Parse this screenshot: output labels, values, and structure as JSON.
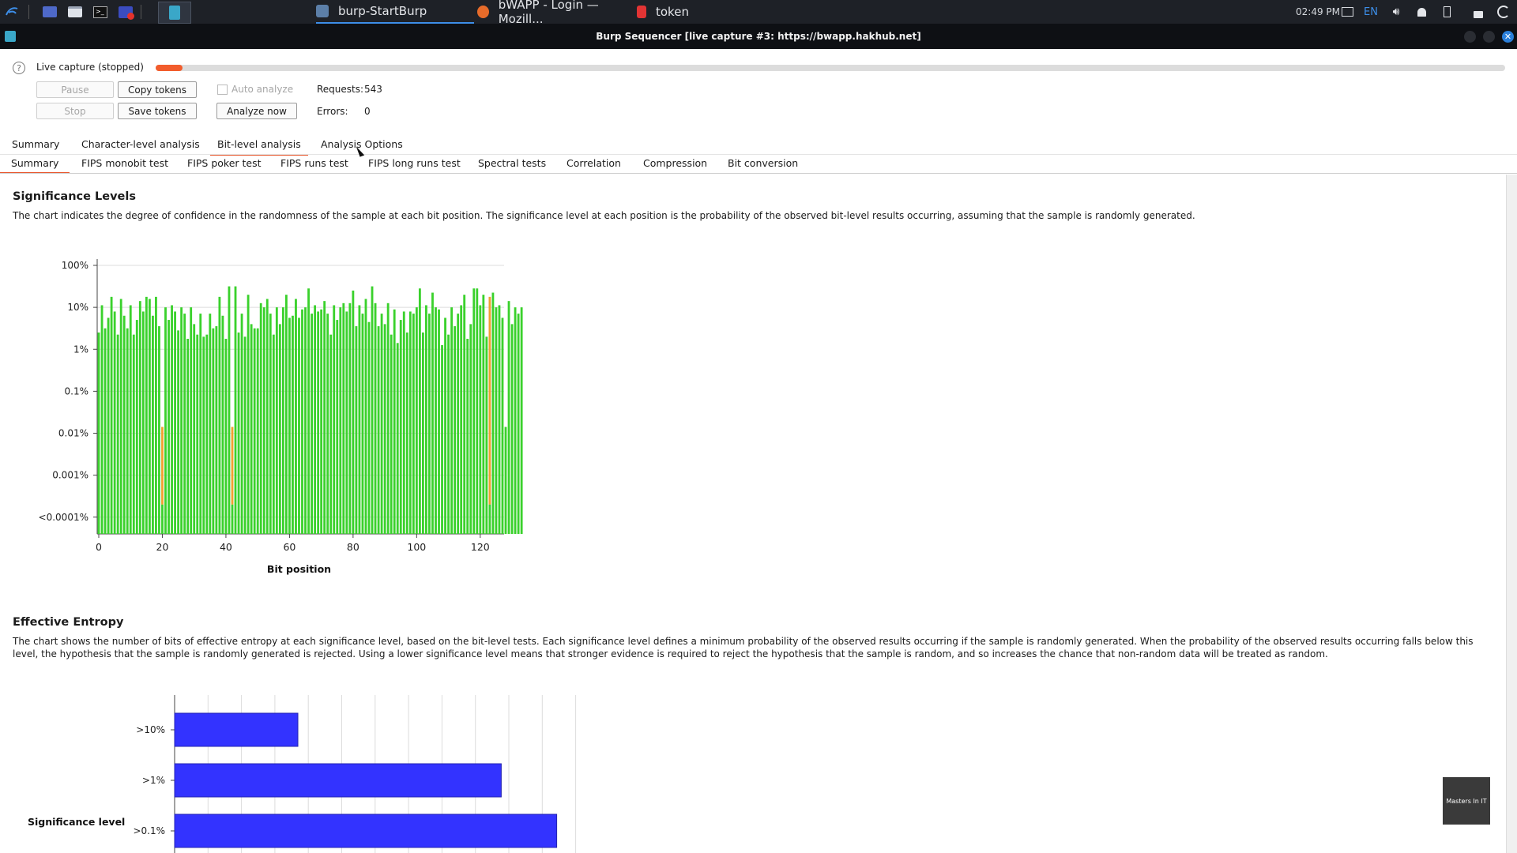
{
  "taskbar": {
    "windows": [
      {
        "label": "burp-StartBurp",
        "icon": "burp-icon",
        "active": true
      },
      {
        "label": "bWAPP - Login — Mozill...",
        "icon": "firefox-icon",
        "active": false
      },
      {
        "label": "token",
        "icon": "document-icon",
        "active": false
      }
    ],
    "time": "02:49 PM",
    "language": "EN"
  },
  "window": {
    "title": "Burp Sequencer [live capture #3: https://bwapp.hakhub.net]"
  },
  "capture": {
    "status_label": "Live capture (stopped)",
    "progress_fraction": 0.02,
    "pause_label": "Pause",
    "stop_label": "Stop",
    "copy_tokens_label": "Copy tokens",
    "save_tokens_label": "Save tokens",
    "auto_analyze_label": "Auto analyze",
    "analyze_now_label": "Analyze now",
    "requests_label": "Requests:",
    "requests_value": "543",
    "errors_label": "Errors:",
    "errors_value": "0"
  },
  "tabs_main": [
    "Summary",
    "Character-level analysis",
    "Bit-level analysis",
    "Analysis Options"
  ],
  "tabs_main_active": 2,
  "tabs_sub": [
    "Summary",
    "FIPS monobit test",
    "FIPS poker test",
    "FIPS runs test",
    "FIPS long runs test",
    "Spectral tests",
    "Correlation",
    "Compression",
    "Bit conversion"
  ],
  "tabs_sub_active": 0,
  "significance": {
    "title": "Significance Levels",
    "description": "The chart indicates the degree of confidence in the randomness of the sample at each bit position. The significance level at each position is the probability of the observed bit-level results occurring, assuming that the sample is randomly generated."
  },
  "entropy": {
    "title": "Effective Entropy",
    "description": "The chart shows the number of bits of effective entropy at each significance level, based on the bit-level tests. Each significance level defines a minimum probability of the observed results occurring if the sample is randomly generated. When the probability of the observed results occurring falls below this level, the hypothesis that the sample is randomly generated is rejected. Using a lower significance level means that stronger evidence is required to reject the hypothesis that the sample is random, and so increases the chance that non-random data will be treated as random."
  },
  "watermark_text": "Masters In IT",
  "colors": {
    "accent": "#e8552b",
    "progress": "#f25c2c",
    "bar_green": "#3ad12c",
    "bar_orange": "#f0a030",
    "bar_blue": "#3333ff"
  },
  "chart_data": [
    {
      "type": "bar",
      "title": "Significance Levels",
      "xlabel": "Bit position",
      "ylabel": "",
      "y_scale": "log",
      "y_tick_labels": [
        "100%",
        "10%",
        "1%",
        "0.1%",
        "0.01%",
        "0.001%",
        "<0.0001%"
      ],
      "x_tick_labels": [
        "0",
        "20",
        "40",
        "60",
        "80",
        "100",
        "120"
      ],
      "xlim": [
        0,
        128
      ],
      "categories": [
        0,
        1,
        2,
        3,
        4,
        5,
        6,
        7,
        8,
        9,
        10,
        11,
        12,
        13,
        14,
        15,
        16,
        17,
        18,
        19,
        20,
        21,
        22,
        23,
        24,
        25,
        26,
        27,
        28,
        29,
        30,
        31,
        32,
        33,
        34,
        35,
        36,
        37,
        38,
        39,
        40,
        41,
        42,
        43,
        44,
        45,
        46,
        47,
        48,
        49,
        50,
        51,
        52,
        53,
        54,
        55,
        56,
        57,
        58,
        59,
        60,
        61,
        62,
        63,
        64,
        65,
        66,
        67,
        68,
        69,
        70,
        71,
        72,
        73,
        74,
        75,
        76,
        77,
        78,
        79,
        80,
        81,
        82,
        83,
        84,
        85,
        86,
        87,
        88,
        89,
        90,
        91,
        92,
        93,
        94,
        95,
        96,
        97,
        98,
        99,
        100,
        101,
        102,
        103,
        104,
        105,
        106,
        107,
        108,
        109,
        110,
        111,
        112,
        113,
        114,
        115,
        116,
        117,
        118,
        119,
        120,
        121,
        122,
        123,
        124,
        125,
        126,
        127
      ],
      "values_log10_percent": [
        0.4,
        1.05,
        0.5,
        0.75,
        1.25,
        0.9,
        0.35,
        1.2,
        0.8,
        0.5,
        1.05,
        0.35,
        0.7,
        1.15,
        0.9,
        1.25,
        1.2,
        0.8,
        1.25,
        0.55,
        -1.85,
        1.0,
        0.7,
        1.05,
        0.9,
        0.45,
        1.0,
        0.85,
        0.25,
        1.0,
        0.6,
        0.35,
        0.85,
        0.3,
        0.35,
        0.85,
        0.5,
        0.55,
        1.25,
        0.8,
        0.25,
        1.5,
        -1.85,
        1.5,
        0.4,
        0.85,
        0.3,
        1.3,
        0.6,
        0.5,
        0.5,
        1.1,
        1.0,
        1.2,
        0.85,
        0.35,
        1.0,
        0.6,
        1.0,
        1.3,
        0.75,
        0.8,
        1.2,
        0.75,
        0.95,
        1.0,
        1.45,
        0.85,
        1.05,
        0.9,
        0.95,
        1.15,
        0.85,
        0.35,
        1.05,
        0.7,
        1.0,
        1.1,
        0.9,
        1.1,
        1.4,
        0.55,
        1.05,
        0.85,
        1.2,
        0.65,
        1.5,
        1.1,
        0.55,
        0.85,
        0.6,
        1.1,
        0.35,
        0.95,
        0.15,
        0.7,
        0.9,
        0.4,
        0.9,
        0.85,
        1.0,
        1.45,
        0.4,
        1.05,
        0.85,
        1.35,
        1.0,
        0.95,
        0.1,
        0.75,
        0.35,
        1.0,
        0.55,
        0.85,
        1.05,
        1.3,
        0.25,
        0.6,
        1.45,
        1.45,
        1.05,
        1.3,
        0.3,
        1.25,
        1.35,
        1.0,
        1.05,
        0.75,
        -1.85,
        1.15,
        0.6,
        1.0,
        0.85,
        1.0
      ],
      "warn_positions": [
        20,
        42,
        123
      ]
    },
    {
      "type": "bar",
      "orientation": "horizontal",
      "title": "Effective Entropy",
      "ylabel": "Significance level",
      "categories": [
        ">10%",
        ">1%",
        ">0.1%"
      ],
      "values": [
        40,
        106,
        124
      ],
      "xlim": [
        0,
        130
      ]
    }
  ]
}
